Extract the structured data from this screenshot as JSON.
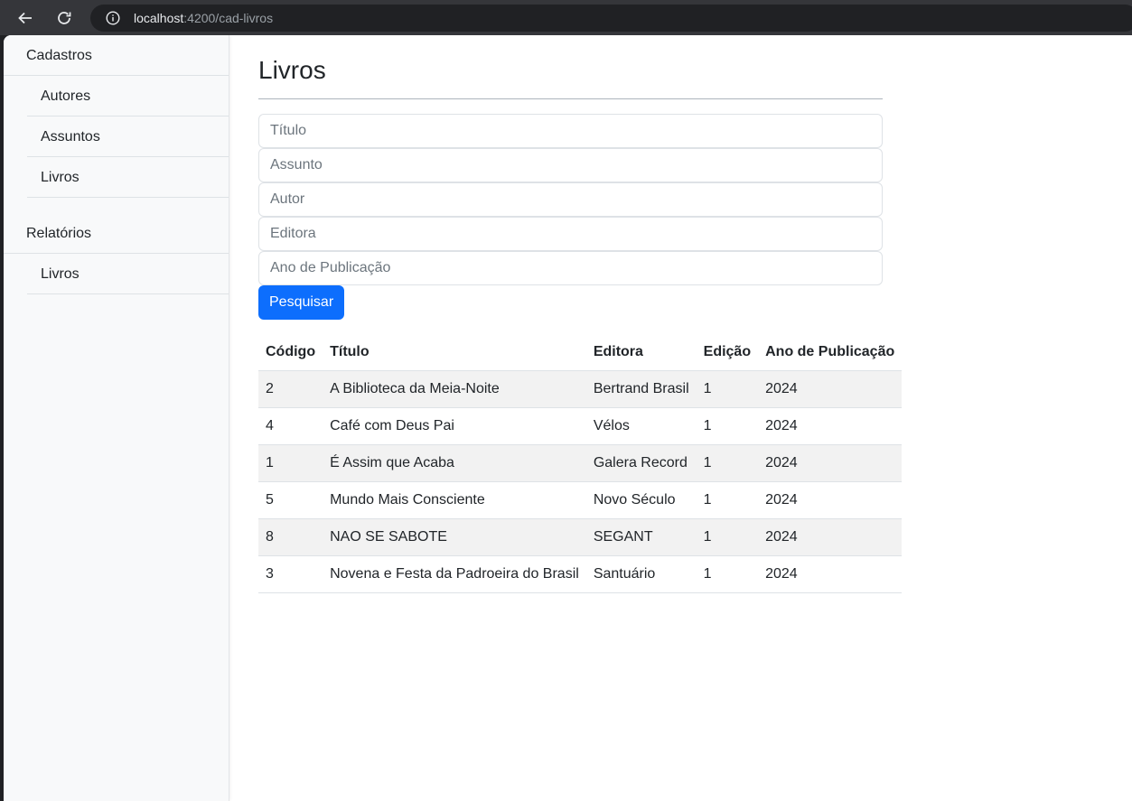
{
  "browser": {
    "url_host": "localhost",
    "url_path": ":4200/cad-livros"
  },
  "sidebar": {
    "groups": [
      {
        "label": "Cadastros",
        "items": [
          {
            "label": "Autores"
          },
          {
            "label": "Assuntos"
          },
          {
            "label": "Livros"
          }
        ]
      },
      {
        "label": "Relatórios",
        "items": [
          {
            "label": "Livros"
          }
        ]
      }
    ]
  },
  "main": {
    "title": "Livros",
    "form": {
      "titulo_placeholder": "Título",
      "assunto_placeholder": "Assunto",
      "autor_placeholder": "Autor",
      "editora_placeholder": "Editora",
      "ano_placeholder": "Ano de Publicação",
      "search_label": "Pesquisar"
    },
    "table": {
      "headers": [
        "Código",
        "Título",
        "Editora",
        "Edição",
        "Ano de Publicação"
      ],
      "rows": [
        [
          "2",
          "A Biblioteca da Meia-Noite",
          "Bertrand Brasil",
          "1",
          "2024"
        ],
        [
          "4",
          "Café com Deus Pai",
          "Vélos",
          "1",
          "2024"
        ],
        [
          "1",
          "É Assim que Acaba",
          "Galera Record",
          "1",
          "2024"
        ],
        [
          "5",
          "Mundo Mais Consciente",
          "Novo Século",
          "1",
          "2024"
        ],
        [
          "8",
          "NAO SE SABOTE",
          "SEGANT",
          "1",
          "2024"
        ],
        [
          "3",
          "Novena e Festa da Padroeira do Brasil",
          "Santuário",
          "1",
          "2024"
        ]
      ]
    }
  },
  "colors": {
    "primary": "#0d6efd",
    "sidebar_bg": "#f8f9fa",
    "stripe": "#f2f2f2"
  }
}
